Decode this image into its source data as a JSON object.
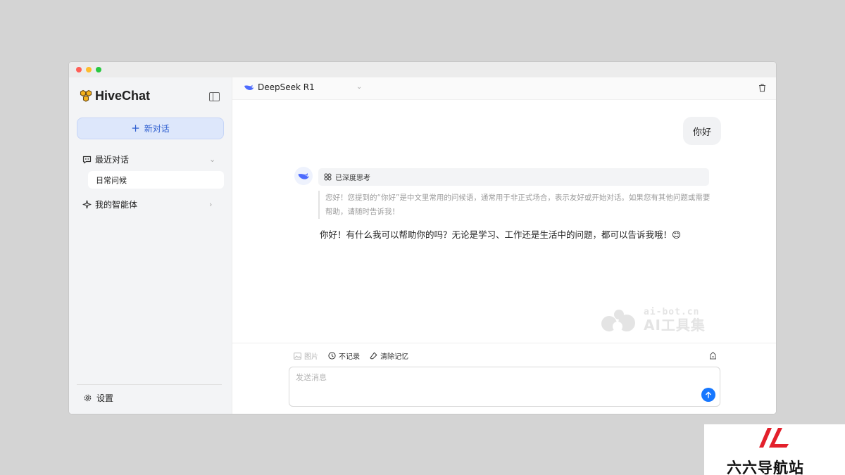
{
  "app": {
    "name": "HiveChat",
    "accent": "#1677ff"
  },
  "sidebar": {
    "new_chat_label": "新对话",
    "recent_label": "最近对话",
    "conversations": [
      {
        "title": "日常问候"
      }
    ],
    "agents_label": "我的智能体",
    "settings_label": "设置"
  },
  "topbar": {
    "model_name": "DeepSeek R1"
  },
  "chat": {
    "user_message": "你好",
    "thinking_label": "已深度思考",
    "thinking_text": "您好！您提到的“你好”是中文里常用的问候语，通常用于非正式场合，表示友好或开始对话。如果您有其他问题或需要帮助，请随时告诉我！",
    "answer_text": "你好！有什么我可以帮助你的吗？无论是学习、工作还是生活中的问题，都可以告诉我哦！😊"
  },
  "composer": {
    "image_label": "图片",
    "no_record_label": "不记录",
    "clear_memory_label": "清除记忆",
    "placeholder": "发送消息"
  },
  "watermark": {
    "domain": "ai-bot.cn",
    "name": "AI工具集"
  },
  "corner_badge": {
    "text": "六六导航站",
    "color": "#e3202b"
  }
}
